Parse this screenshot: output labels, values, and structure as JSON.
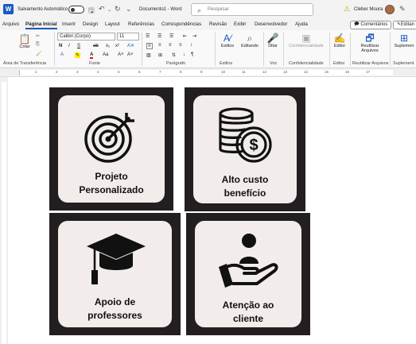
{
  "titlebar": {
    "app_icon": "W",
    "autosave_label": "Salvamento Automático",
    "doc_title": "Documento1 - Word",
    "search_placeholder": "Pesquisar",
    "user_name": "Cleber Moura",
    "warning_icon": "warning-icon"
  },
  "menu": {
    "tabs": [
      "Arquivo",
      "Página Inicial",
      "Inserir",
      "Design",
      "Layout",
      "Referências",
      "Correspondências",
      "Revisão",
      "Exibir",
      "Desenvolvedor",
      "Ajuda"
    ],
    "comments_label": "Comentários",
    "editing_label": "Editan"
  },
  "ribbon": {
    "paste_label": "Colar",
    "clipboard_group": "Área de Transferência",
    "font_name": "Calibri (Corpo)",
    "font_size": "11",
    "font_group": "Fonte",
    "paragraph_group": "Parágrafo",
    "styles_label": "Estilos",
    "styles_group": "Estilos",
    "editing_button": "Editando",
    "dictate_label": "Ditar",
    "voice_group": "Voz",
    "sensitivity_label": "Confidencialidade",
    "sensitivity_group": "Confidencialidade",
    "editor_label": "Editor",
    "editor_group": "Editor",
    "reuse_label": "Reutilizar Arquivos",
    "reuse_group": "Reutilizar Arquivos",
    "addins_label": "Suplemen",
    "addins_group": "Suplement",
    "font_buttons": [
      "N",
      "I",
      "S",
      "ab",
      "x₂",
      "x²"
    ]
  },
  "ruler": {
    "ticks": [
      "1",
      "2",
      "3",
      "4",
      "5",
      "6",
      "7",
      "8",
      "9",
      "10",
      "11",
      "12",
      "13",
      "14",
      "15",
      "16",
      "17"
    ]
  },
  "cards": [
    {
      "line1": "Projeto",
      "line2": "Personalizado",
      "icon": "target-icon"
    },
    {
      "line1": "Alto custo",
      "line2": "benefício",
      "icon": "coins-dollar-icon"
    },
    {
      "line1": "Apoio de",
      "line2": "professores",
      "icon": "graduation-cap-icon"
    },
    {
      "line1": "Atenção ao",
      "line2": "cliente",
      "icon": "hand-care-person-icon"
    }
  ],
  "colors": {
    "accent": "#185abd",
    "card_border": "#231f20",
    "card_fill": "#f2ecea"
  }
}
